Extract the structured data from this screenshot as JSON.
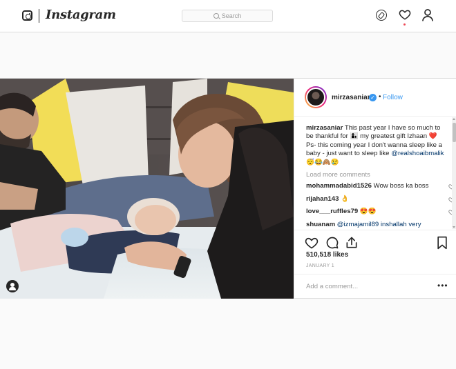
{
  "brand": {
    "name": "Instagram"
  },
  "search": {
    "placeholder": "Search"
  },
  "post": {
    "author": "mirzasaniar",
    "follow_label": "Follow",
    "dot": "•",
    "caption_user": "mirzasaniar",
    "caption_text": "This past year I have so much to be thankful for 👩‍👦 my greatest gift Izhaan ❤️ Ps- this coming year I don't wanna sleep like a baby - just want to sleep like",
    "caption_mention": "@realshoaibmalik",
    "caption_emoji": "😴😂🙈😢",
    "load_more": "Load more comments",
    "comments": [
      {
        "user": "mohammadabid1526",
        "text": "Wow boss ka boss"
      },
      {
        "user": "rijahan143",
        "text": "👌"
      },
      {
        "user": "love___ruffles79",
        "text": "😍😍"
      },
      {
        "user": "shuanam",
        "text": "@izmajamil89 inshallah very"
      }
    ],
    "likes": "510,518 likes",
    "date": "JANUARY 1",
    "add_comment_placeholder": "Add a comment...",
    "more_label": "•••"
  }
}
